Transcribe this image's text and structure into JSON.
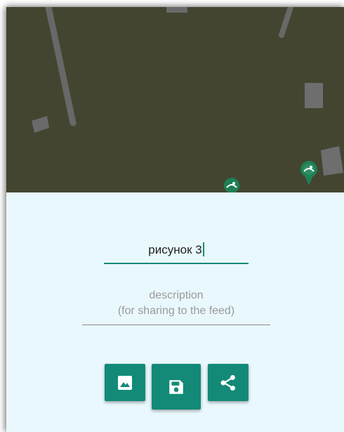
{
  "map": {
    "background": "#434530",
    "pin_icon": "map-pin-icon"
  },
  "form": {
    "title_value": "рисунок 3",
    "description_placeholder_line1": "description",
    "description_placeholder_line2": "(for sharing to the feed)",
    "accent_color": "#148a78"
  },
  "actions": [
    {
      "name": "image",
      "icon": "image-icon"
    },
    {
      "name": "save",
      "icon": "save-icon"
    },
    {
      "name": "share",
      "icon": "share-icon"
    }
  ]
}
